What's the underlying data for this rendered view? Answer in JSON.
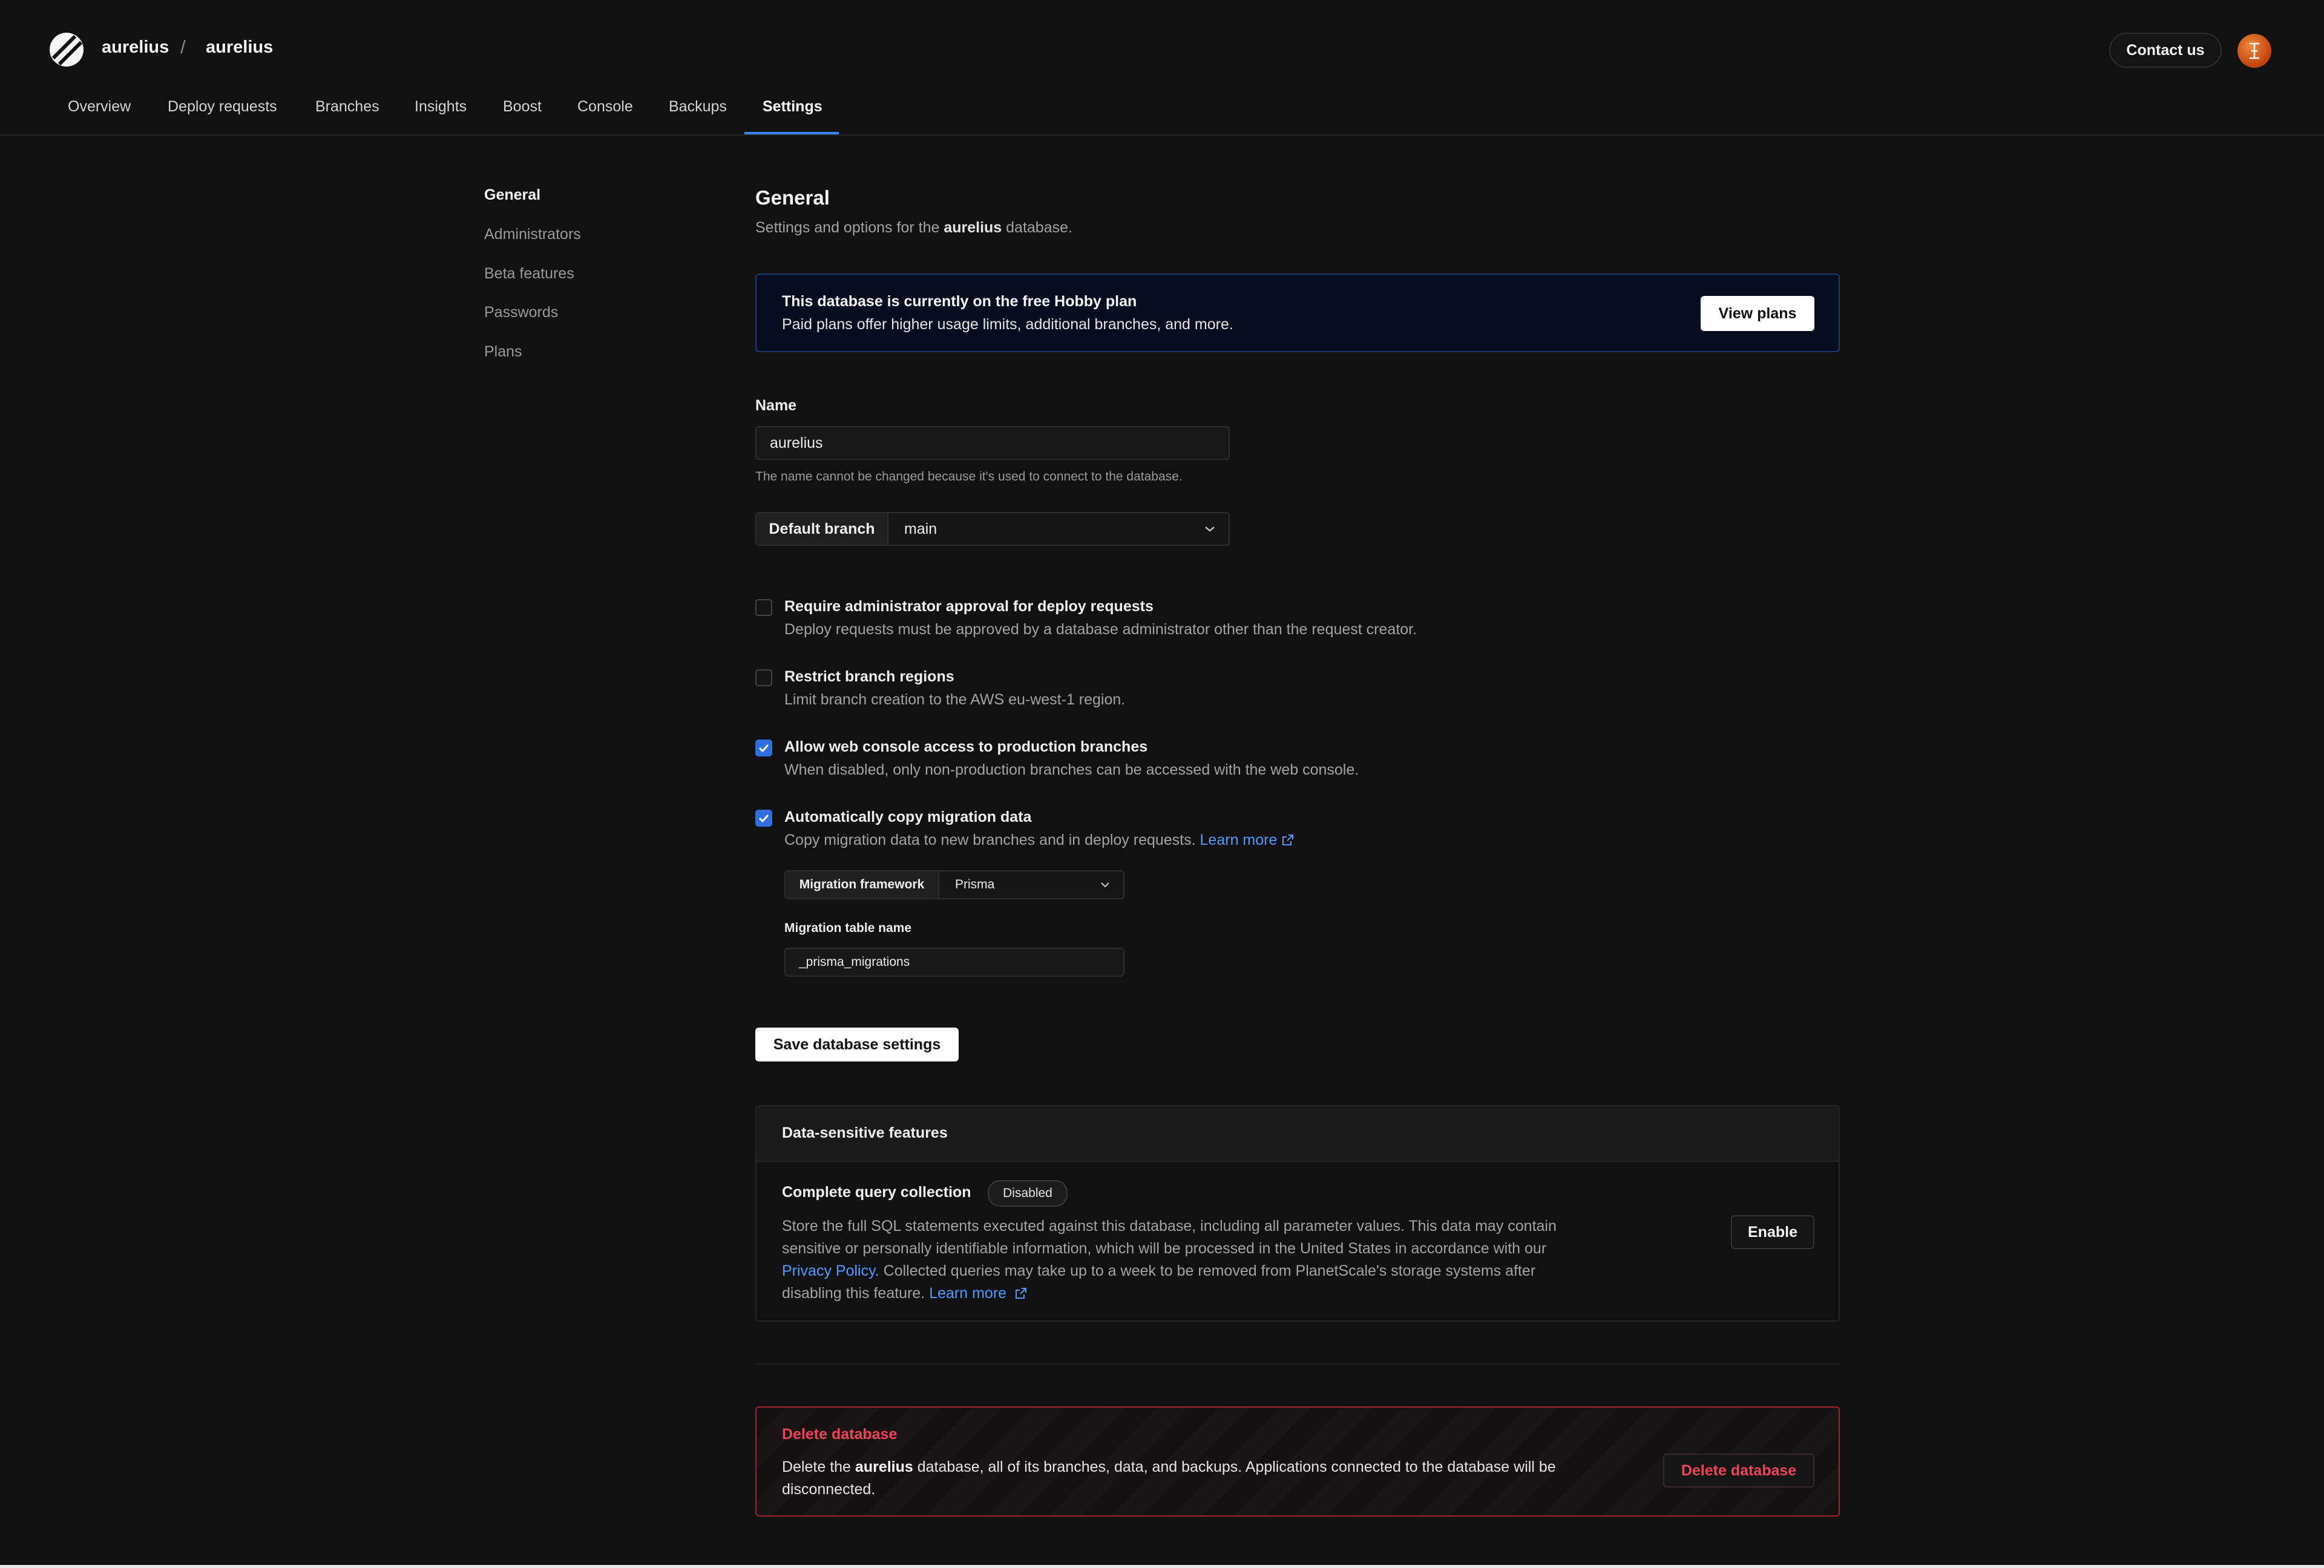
{
  "header": {
    "org": "aurelius",
    "separator": "/",
    "database": "aurelius",
    "contact_label": "Contact us",
    "avatar_initial": "I"
  },
  "tabs": [
    {
      "label": "Overview"
    },
    {
      "label": "Deploy requests"
    },
    {
      "label": "Branches"
    },
    {
      "label": "Insights"
    },
    {
      "label": "Boost"
    },
    {
      "label": "Console"
    },
    {
      "label": "Backups"
    },
    {
      "label": "Settings",
      "active": true
    }
  ],
  "sidebar": {
    "items": [
      {
        "label": "General",
        "active": true
      },
      {
        "label": "Administrators"
      },
      {
        "label": "Beta features"
      },
      {
        "label": "Passwords"
      },
      {
        "label": "Plans"
      }
    ]
  },
  "general": {
    "title": "General",
    "subtitle_pre": "Settings and options for the ",
    "subtitle_db": "aurelius",
    "subtitle_post": " database."
  },
  "banner": {
    "title": "This database is currently on the free Hobby plan",
    "text": "Paid plans offer higher usage limits, additional branches, and more.",
    "button": "View plans"
  },
  "name_field": {
    "label": "Name",
    "value": "aurelius",
    "hint": "The name cannot be changed because it's used to connect to the database."
  },
  "default_branch": {
    "label": "Default branch",
    "value": "main"
  },
  "options": [
    {
      "title": "Require administrator approval for deploy requests",
      "desc": "Deploy requests must be approved by a database administrator other than the request creator.",
      "checked": false
    },
    {
      "title": "Restrict branch regions",
      "desc": "Limit branch creation to the AWS eu-west-1 region.",
      "checked": false
    },
    {
      "title": "Allow web console access to production branches",
      "desc": "When disabled, only non-production branches can be accessed with the web console.",
      "checked": true
    },
    {
      "title": "Automatically copy migration data",
      "desc": "Copy migration data to new branches and in deploy requests.",
      "link": "Learn more",
      "checked": true
    }
  ],
  "migration": {
    "framework_label": "Migration framework",
    "framework_value": "Prisma",
    "table_label": "Migration table name",
    "table_value": "_prisma_migrations"
  },
  "save_button": "Save database settings",
  "data_sensitive": {
    "title": "Data-sensitive features",
    "feature_title": "Complete query collection",
    "status": "Disabled",
    "text_1": "Store the full SQL statements executed against this database, including all parameter values. This data may contain",
    "text_2": "sensitive or personally identifiable information, which will be processed in the United States in accordance with our",
    "privacy_link": "Privacy Policy",
    "text_3": ". Collected queries may take up to a week to be removed from PlanetScale's storage systems after",
    "text_4": "disabling this feature. ",
    "learn_more": "Learn more",
    "button": "Enable"
  },
  "danger": {
    "title": "Delete database",
    "text_pre": "Delete the ",
    "text_db": "aurelius",
    "text_post": " database, all of its branches, data, and backups. Applications connected to the database will be disconnected.",
    "button": "Delete database"
  },
  "colors": {
    "accent": "#3b82f6",
    "link": "#4f9bff",
    "danger": "#f0435a",
    "banner_bg": "#050d1f"
  }
}
